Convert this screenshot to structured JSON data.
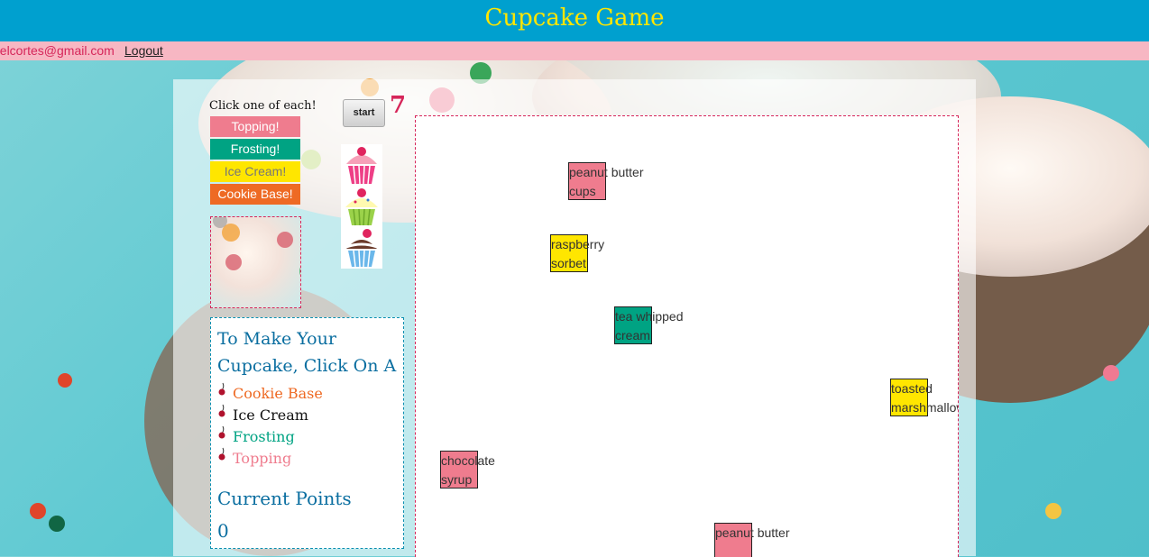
{
  "header": {
    "title": "Cupcake Game"
  },
  "userbar": {
    "email": "belcortes@gmail.com",
    "logout": "Logout"
  },
  "controls": {
    "instructions": "Click one of each!",
    "start_label": "start",
    "timer": "7"
  },
  "categories": [
    {
      "label": "Topping!"
    },
    {
      "label": "Frosting!"
    },
    {
      "label": "Ice Cream!"
    },
    {
      "label": "Cookie Base!"
    }
  ],
  "recipe": {
    "title": "To Make Your Cupcake, Click On A",
    "steps": [
      {
        "label": "Cookie Base",
        "color": "#ee6a24"
      },
      {
        "label": "Ice Cream",
        "color": "#111111"
      },
      {
        "label": "Frosting",
        "color": "#00a383"
      },
      {
        "label": "Topping",
        "color": "#ef7c8e"
      }
    ],
    "points_title": "Current Points",
    "points_value": "0"
  },
  "board": {
    "items": [
      {
        "text": "peanut butter cups",
        "color": "pink"
      },
      {
        "text": "raspberry sorbet",
        "color": "yellow"
      },
      {
        "text": "tea whipped cream",
        "color": "green"
      },
      {
        "text": "toasted marshmallow",
        "color": "yellow"
      },
      {
        "text": "chocolate syrup",
        "color": "pink"
      },
      {
        "text": "peanut butter",
        "color": "pink"
      }
    ]
  },
  "colors": {
    "header_bg": "#00a0cf",
    "title": "#ffe600",
    "userbar_bg": "#f7b7c3",
    "pink": "#ef7c8e",
    "green": "#00a383",
    "yellow": "#ffe600",
    "orange": "#ee6a24"
  },
  "icons": [
    "pink-cupcake-icon",
    "green-cupcake-icon",
    "blue-cupcake-icon",
    "cherry-icon"
  ]
}
